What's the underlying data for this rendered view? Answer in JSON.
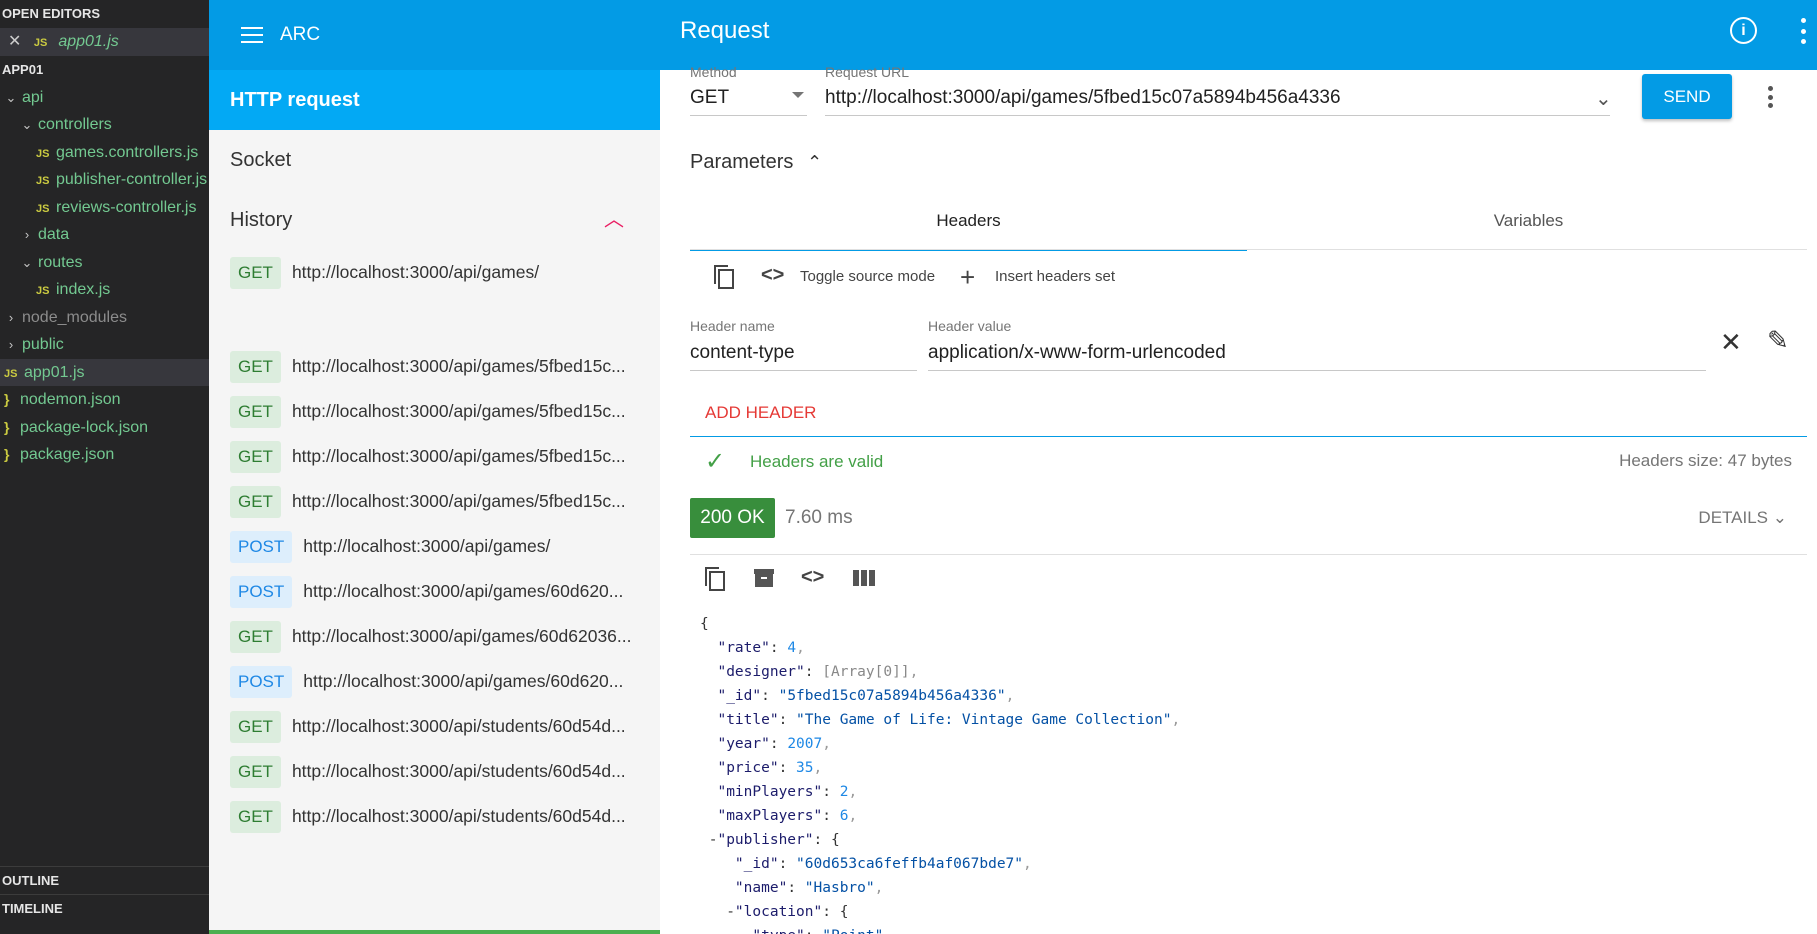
{
  "explorer": {
    "open_editors_title": "OPEN EDITORS",
    "open_editor": {
      "name": "app01.js",
      "badge": "JS"
    },
    "project_title": "APP01",
    "tree": [
      {
        "label": "api",
        "kind": "folder",
        "open": true,
        "depth": 0,
        "color": "green"
      },
      {
        "label": "controllers",
        "kind": "folder",
        "open": true,
        "depth": 1,
        "color": "green"
      },
      {
        "label": "games.controllers.js",
        "kind": "js",
        "depth": 2,
        "color": "green"
      },
      {
        "label": "publisher-controller.js",
        "kind": "js",
        "depth": 2,
        "color": "green"
      },
      {
        "label": "reviews-controller.js",
        "kind": "js",
        "depth": 2,
        "color": "green"
      },
      {
        "label": "data",
        "kind": "folder",
        "open": false,
        "depth": 1,
        "color": "green"
      },
      {
        "label": "routes",
        "kind": "folder",
        "open": true,
        "depth": 1,
        "color": "green"
      },
      {
        "label": "index.js",
        "kind": "js",
        "depth": 2,
        "color": "green"
      },
      {
        "label": "node_modules",
        "kind": "folder",
        "open": false,
        "depth": 0,
        "color": "grey"
      },
      {
        "label": "public",
        "kind": "folder",
        "open": false,
        "depth": 0,
        "color": "green"
      },
      {
        "label": "app01.js",
        "kind": "js",
        "depth": 0,
        "color": "green",
        "active": true
      },
      {
        "label": "nodemon.json",
        "kind": "json",
        "depth": 0,
        "color": "green"
      },
      {
        "label": "package-lock.json",
        "kind": "json",
        "depth": 0,
        "color": "green"
      },
      {
        "label": "package.json",
        "kind": "json",
        "depth": 0,
        "color": "green"
      }
    ],
    "outline_title": "OUTLINE",
    "timeline_title": "TIMELINE"
  },
  "arc_nav": {
    "app_name": "ARC",
    "http_request": "HTTP request",
    "socket": "Socket",
    "history": "History",
    "history_items": [
      {
        "method": "GET",
        "url": "http://localhost:3000/api/games/"
      },
      {
        "method": "GET",
        "url": "http://localhost:3000/api/games/5fbed15c..."
      },
      {
        "method": "GET",
        "url": "http://localhost:3000/api/games/5fbed15c..."
      },
      {
        "method": "GET",
        "url": "http://localhost:3000/api/games/5fbed15c..."
      },
      {
        "method": "GET",
        "url": "http://localhost:3000/api/games/5fbed15c..."
      },
      {
        "method": "POST",
        "url": "http://localhost:3000/api/games/"
      },
      {
        "method": "POST",
        "url": "http://localhost:3000/api/games/60d620..."
      },
      {
        "method": "GET",
        "url": "http://localhost:3000/api/games/60d62036..."
      },
      {
        "method": "POST",
        "url": "http://localhost:3000/api/games/60d620..."
      },
      {
        "method": "GET",
        "url": "http://localhost:3000/api/students/60d54d..."
      },
      {
        "method": "GET",
        "url": "http://localhost:3000/api/students/60d54d..."
      },
      {
        "method": "GET",
        "url": "http://localhost:3000/api/students/60d54d..."
      }
    ]
  },
  "request": {
    "page_title": "Request",
    "info_icon": "i",
    "method_label": "Method",
    "method_value": "GET",
    "url_label": "Request URL",
    "url_value": "http://localhost:3000/api/games/5fbed15c07a5894b456a4336",
    "send_label": "SEND",
    "parameters_label": "Parameters",
    "tabs": [
      "Headers",
      "Variables"
    ],
    "toggle_source_label": "Toggle source mode",
    "insert_headers_label": "Insert headers set",
    "header_name_label": "Header name",
    "header_name_value": "content-type",
    "header_value_label": "Header value",
    "header_value_value": "application/x-www-form-urlencoded",
    "add_header_label": "ADD HEADER",
    "headers_valid_label": "Headers are valid",
    "headers_size_label": "Headers size: 47 bytes"
  },
  "response": {
    "status": "200 OK",
    "time": "7.60 ms",
    "details_label": "DETAILS",
    "json_lines": [
      [
        {
          "t": "p",
          "v": "{"
        }
      ],
      [
        {
          "t": "i",
          "v": "  "
        },
        {
          "t": "k",
          "v": "\"rate\""
        },
        {
          "t": "p",
          "v": ": "
        },
        {
          "t": "n",
          "v": "4"
        },
        {
          "t": "p",
          "v": ","
        }
      ],
      [
        {
          "t": "i",
          "v": "  "
        },
        {
          "t": "k",
          "v": "\"designer\""
        },
        {
          "t": "p",
          "v": ": "
        },
        {
          "t": "a",
          "v": "[Array[0]]"
        },
        {
          "t": "p",
          "v": ","
        }
      ],
      [
        {
          "t": "i",
          "v": "  "
        },
        {
          "t": "k",
          "v": "\"_id\""
        },
        {
          "t": "p",
          "v": ": "
        },
        {
          "t": "s",
          "v": "\"5fbed15c07a5894b456a4336\""
        },
        {
          "t": "p",
          "v": ","
        }
      ],
      [
        {
          "t": "i",
          "v": "  "
        },
        {
          "t": "k",
          "v": "\"title\""
        },
        {
          "t": "p",
          "v": ": "
        },
        {
          "t": "s",
          "v": "\"The Game of Life: Vintage Game Collection\""
        },
        {
          "t": "p",
          "v": ","
        }
      ],
      [
        {
          "t": "i",
          "v": "  "
        },
        {
          "t": "k",
          "v": "\"year\""
        },
        {
          "t": "p",
          "v": ": "
        },
        {
          "t": "n",
          "v": "2007"
        },
        {
          "t": "p",
          "v": ","
        }
      ],
      [
        {
          "t": "i",
          "v": "  "
        },
        {
          "t": "k",
          "v": "\"price\""
        },
        {
          "t": "p",
          "v": ": "
        },
        {
          "t": "n",
          "v": "35"
        },
        {
          "t": "p",
          "v": ","
        }
      ],
      [
        {
          "t": "i",
          "v": "  "
        },
        {
          "t": "k",
          "v": "\"minPlayers\""
        },
        {
          "t": "p",
          "v": ": "
        },
        {
          "t": "n",
          "v": "2"
        },
        {
          "t": "p",
          "v": ","
        }
      ],
      [
        {
          "t": "i",
          "v": "  "
        },
        {
          "t": "k",
          "v": "\"maxPlayers\""
        },
        {
          "t": "p",
          "v": ": "
        },
        {
          "t": "n",
          "v": "6"
        },
        {
          "t": "p",
          "v": ","
        }
      ],
      [
        {
          "t": "i",
          "v": " -"
        },
        {
          "t": "k",
          "v": "\"publisher\""
        },
        {
          "t": "p",
          "v": ": {"
        }
      ],
      [
        {
          "t": "i",
          "v": "    "
        },
        {
          "t": "k",
          "v": "\"_id\""
        },
        {
          "t": "p",
          "v": ": "
        },
        {
          "t": "s",
          "v": "\"60d653ca6feffb4af067bde7\""
        },
        {
          "t": "p",
          "v": ","
        }
      ],
      [
        {
          "t": "i",
          "v": "    "
        },
        {
          "t": "k",
          "v": "\"name\""
        },
        {
          "t": "p",
          "v": ": "
        },
        {
          "t": "s",
          "v": "\"Hasbro\""
        },
        {
          "t": "p",
          "v": ","
        }
      ],
      [
        {
          "t": "i",
          "v": "   -"
        },
        {
          "t": "k",
          "v": "\"location\""
        },
        {
          "t": "p",
          "v": ": {"
        }
      ],
      [
        {
          "t": "i",
          "v": "      "
        },
        {
          "t": "k",
          "v": "\"type\""
        },
        {
          "t": "p",
          "v": ": "
        },
        {
          "t": "s",
          "v": "\"Point\""
        },
        {
          "t": "p",
          "v": ","
        }
      ]
    ]
  },
  "colors": {
    "appbar": "#039be5",
    "nav_selected": "#03a9f4",
    "status_ok": "#388e3c",
    "add_header": "#e53935"
  }
}
